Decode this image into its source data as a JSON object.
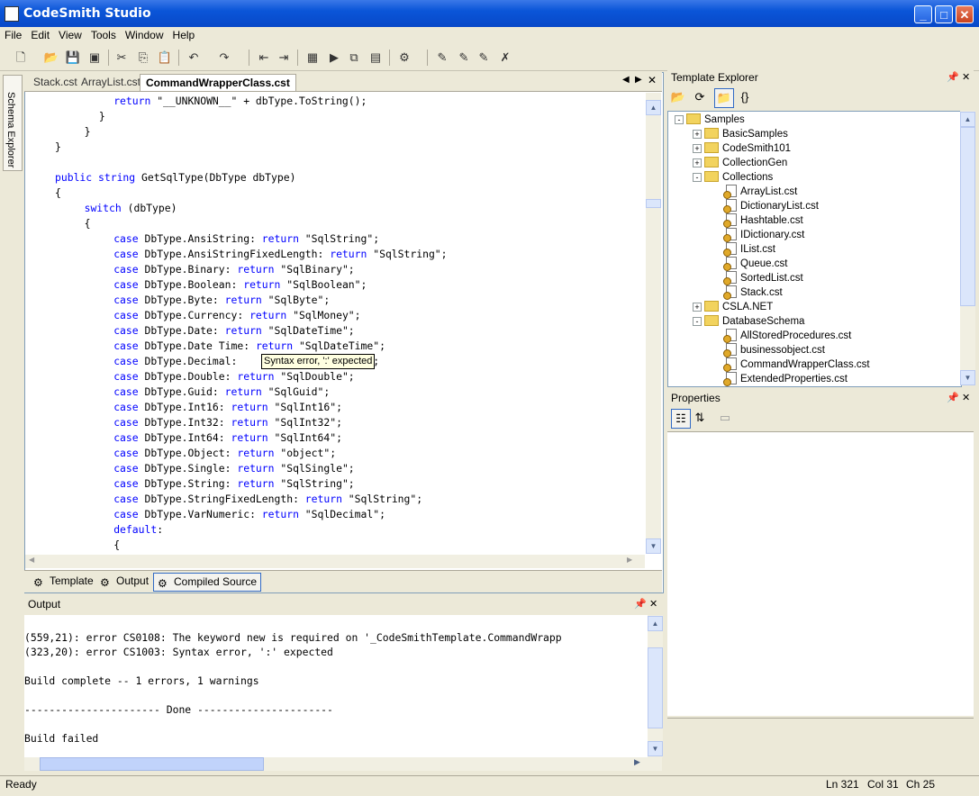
{
  "window": {
    "title": "CodeSmith Studio",
    "minimize": "_",
    "maximize": "□",
    "close": "✕"
  },
  "menu": [
    "File",
    "Edit",
    "View",
    "Tools",
    "Window",
    "Help"
  ],
  "doc_tabs": [
    {
      "label": "Stack.cst"
    },
    {
      "label": "ArrayList.cst"
    },
    {
      "label": "CommandWrapperClass.cst"
    }
  ],
  "side_tab": "Schema Explorer",
  "code_lines": [
    {
      "indent": 8,
      "parts": [
        [
          "kw",
          "return"
        ],
        [
          "st",
          " \"__UNKNOWN__\" + dbType.ToString();"
        ]
      ]
    },
    {
      "indent": 6,
      "parts": [
        [
          "st",
          "}"
        ]
      ]
    },
    {
      "indent": 4,
      "parts": [
        [
          "st",
          "}"
        ]
      ]
    },
    {
      "indent": 0,
      "parts": [
        [
          "st",
          "}"
        ]
      ]
    },
    {
      "indent": 0,
      "parts": [
        [
          "st",
          ""
        ]
      ]
    },
    {
      "indent": 0,
      "parts": [
        [
          "kw",
          "public string"
        ],
        [
          "st",
          " GetSqlType(DbType dbType)"
        ]
      ]
    },
    {
      "indent": 0,
      "parts": [
        [
          "st",
          "{"
        ]
      ]
    },
    {
      "indent": 4,
      "parts": [
        [
          "kw",
          "switch"
        ],
        [
          "st",
          " (dbType)"
        ]
      ]
    },
    {
      "indent": 4,
      "parts": [
        [
          "st",
          "{"
        ]
      ]
    },
    {
      "indent": 8,
      "parts": [
        [
          "kw",
          "case"
        ],
        [
          "st",
          " DbType.AnsiString: "
        ],
        [
          "kw",
          "return"
        ],
        [
          "st",
          " \"SqlString\";"
        ]
      ]
    },
    {
      "indent": 8,
      "parts": [
        [
          "kw",
          "case"
        ],
        [
          "st",
          " DbType.AnsiStringFixedLength: "
        ],
        [
          "kw",
          "return"
        ],
        [
          "st",
          " \"SqlString\";"
        ]
      ]
    },
    {
      "indent": 8,
      "parts": [
        [
          "kw",
          "case"
        ],
        [
          "st",
          " DbType.Binary: "
        ],
        [
          "kw",
          "return"
        ],
        [
          "st",
          " \"SqlBinary\";"
        ]
      ]
    },
    {
      "indent": 8,
      "parts": [
        [
          "kw",
          "case"
        ],
        [
          "st",
          " DbType.Boolean: "
        ],
        [
          "kw",
          "return"
        ],
        [
          "st",
          " \"SqlBoolean\";"
        ]
      ]
    },
    {
      "indent": 8,
      "parts": [
        [
          "kw",
          "case"
        ],
        [
          "st",
          " DbType.Byte: "
        ],
        [
          "kw",
          "return"
        ],
        [
          "st",
          " \"SqlByte\";"
        ]
      ]
    },
    {
      "indent": 8,
      "parts": [
        [
          "kw",
          "case"
        ],
        [
          "st",
          " DbType.Currency: "
        ],
        [
          "kw",
          "return"
        ],
        [
          "st",
          " \"SqlMoney\";"
        ]
      ]
    },
    {
      "indent": 8,
      "parts": [
        [
          "kw",
          "case"
        ],
        [
          "st",
          " DbType.Date: "
        ],
        [
          "kw",
          "return"
        ],
        [
          "st",
          " \"SqlDateTime\";"
        ]
      ]
    },
    {
      "indent": 8,
      "parts": [
        [
          "kw",
          "case"
        ],
        [
          "st",
          " DbType.Date Time: "
        ],
        [
          "kw",
          "return"
        ],
        [
          "st",
          " \"SqlDateTime\";"
        ]
      ]
    },
    {
      "indent": 8,
      "parts": [
        [
          "kw",
          "case"
        ],
        [
          "st",
          " DbType.Decimal: "
        ],
        [
          "st",
          "                  al\";"
        ]
      ]
    },
    {
      "indent": 8,
      "parts": [
        [
          "kw",
          "case"
        ],
        [
          "st",
          " DbType.Double: "
        ],
        [
          "kw",
          "return"
        ],
        [
          "st",
          " \"SqlDouble\";"
        ]
      ]
    },
    {
      "indent": 8,
      "parts": [
        [
          "kw",
          "case"
        ],
        [
          "st",
          " DbType.Guid: "
        ],
        [
          "kw",
          "return"
        ],
        [
          "st",
          " \"SqlGuid\";"
        ]
      ]
    },
    {
      "indent": 8,
      "parts": [
        [
          "kw",
          "case"
        ],
        [
          "st",
          " DbType.Int16: "
        ],
        [
          "kw",
          "return"
        ],
        [
          "st",
          " \"SqlInt16\";"
        ]
      ]
    },
    {
      "indent": 8,
      "parts": [
        [
          "kw",
          "case"
        ],
        [
          "st",
          " DbType.Int32: "
        ],
        [
          "kw",
          "return"
        ],
        [
          "st",
          " \"SqlInt32\";"
        ]
      ]
    },
    {
      "indent": 8,
      "parts": [
        [
          "kw",
          "case"
        ],
        [
          "st",
          " DbType.Int64: "
        ],
        [
          "kw",
          "return"
        ],
        [
          "st",
          " \"SqlInt64\";"
        ]
      ]
    },
    {
      "indent": 8,
      "parts": [
        [
          "kw",
          "case"
        ],
        [
          "st",
          " DbType.Object: "
        ],
        [
          "kw",
          "return"
        ],
        [
          "st",
          " \"object\";"
        ]
      ]
    },
    {
      "indent": 8,
      "parts": [
        [
          "kw",
          "case"
        ],
        [
          "st",
          " DbType.Single: "
        ],
        [
          "kw",
          "return"
        ],
        [
          "st",
          " \"SqlSingle\";"
        ]
      ]
    },
    {
      "indent": 8,
      "parts": [
        [
          "kw",
          "case"
        ],
        [
          "st",
          " DbType.String: "
        ],
        [
          "kw",
          "return"
        ],
        [
          "st",
          " \"SqlString\";"
        ]
      ]
    },
    {
      "indent": 8,
      "parts": [
        [
          "kw",
          "case"
        ],
        [
          "st",
          " DbType.StringFixedLength: "
        ],
        [
          "kw",
          "return"
        ],
        [
          "st",
          " \"SqlString\";"
        ]
      ]
    },
    {
      "indent": 8,
      "parts": [
        [
          "kw",
          "case"
        ],
        [
          "st",
          " DbType.VarNumeric: "
        ],
        [
          "kw",
          "return"
        ],
        [
          "st",
          " \"SqlDecimal\";"
        ]
      ]
    },
    {
      "indent": 8,
      "parts": [
        [
          "kw",
          "default"
        ],
        [
          "st",
          ":"
        ]
      ]
    },
    {
      "indent": 8,
      "parts": [
        [
          "st",
          "{"
        ]
      ]
    }
  ],
  "tooltip": "Syntax error, ':' expected",
  "bottom_tabs": [
    "Template",
    "Output",
    "Compiled Source"
  ],
  "output": {
    "title": "Output",
    "lines": [
      "",
      "(559,21): error CS0108: The keyword new is required on '_CodeSmithTemplate.CommandWrapp",
      "(323,20): error CS1003: Syntax error, ':' expected",
      "",
      "Build complete -- 1 errors, 1 warnings",
      "",
      "---------------------- Done ----------------------",
      "",
      "Build failed"
    ]
  },
  "template_explorer": {
    "title": "Template Explorer",
    "tree": [
      {
        "label": "Samples",
        "level": 0,
        "type": "folder",
        "expander": "-"
      },
      {
        "label": "BasicSamples",
        "level": 1,
        "type": "folder",
        "expander": "+"
      },
      {
        "label": "CodeSmith101",
        "level": 1,
        "type": "folder",
        "expander": "+"
      },
      {
        "label": "CollectionGen",
        "level": 1,
        "type": "folder",
        "expander": "+"
      },
      {
        "label": "Collections",
        "level": 1,
        "type": "folder",
        "expander": "-"
      },
      {
        "label": "ArrayList.cst",
        "level": 2,
        "type": "file"
      },
      {
        "label": "DictionaryList.cst",
        "level": 2,
        "type": "file"
      },
      {
        "label": "Hashtable.cst",
        "level": 2,
        "type": "file"
      },
      {
        "label": "IDictionary.cst",
        "level": 2,
        "type": "file"
      },
      {
        "label": "IList.cst",
        "level": 2,
        "type": "file"
      },
      {
        "label": "Queue.cst",
        "level": 2,
        "type": "file"
      },
      {
        "label": "SortedList.cst",
        "level": 2,
        "type": "file"
      },
      {
        "label": "Stack.cst",
        "level": 2,
        "type": "file"
      },
      {
        "label": "CSLA.NET",
        "level": 1,
        "type": "folder",
        "expander": "+"
      },
      {
        "label": "DatabaseSchema",
        "level": 1,
        "type": "folder",
        "expander": "-"
      },
      {
        "label": "AllStoredProcedures.cst",
        "level": 2,
        "type": "file"
      },
      {
        "label": "businessobject.cst",
        "level": 2,
        "type": "file"
      },
      {
        "label": "CommandWrapperClass.cst",
        "level": 2,
        "type": "file"
      },
      {
        "label": "ExtendedProperties.cst",
        "level": 2,
        "type": "file"
      }
    ]
  },
  "properties": {
    "title": "Properties"
  },
  "status": {
    "text": "Ready",
    "line": "Ln 321",
    "col": "Col 31",
    "ch": "Ch 25"
  }
}
